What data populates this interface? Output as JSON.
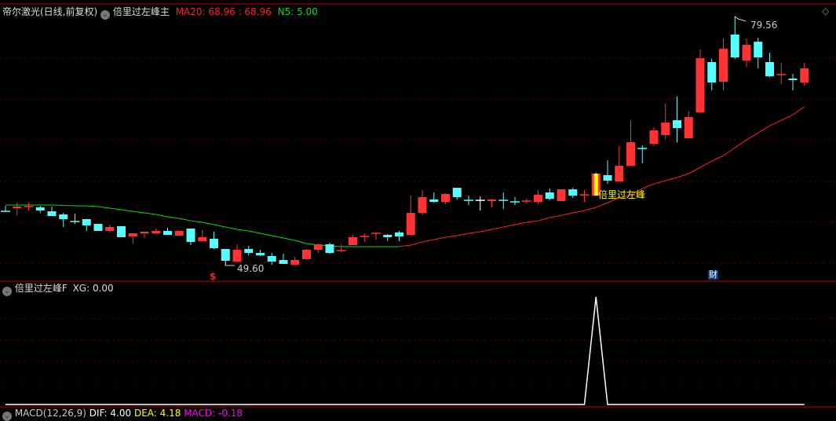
{
  "main_panel": {
    "stock_name": "帝尔激光(日线,前复权)",
    "indicator_name": "倍里过左峰主",
    "ma20_label": "MA20: 68.96",
    "ma20_value2": ": 68.96",
    "n5_label": "N5: 5.00",
    "high_marker": "79.56",
    "low_marker": "49.60",
    "signal_label": "倍里过左峰",
    "dollar_marker": "$",
    "finance_badge": "财",
    "colors": {
      "up": "#ff3333",
      "down": "#54ffff",
      "ma_up": "#ff2020",
      "ma_down": "#00e000",
      "signal": "#ffff00",
      "grid": "#8b0000",
      "border": "#c00000"
    }
  },
  "sub_panel": {
    "indicator_name": "倍里过左峰F",
    "xg_label": "XG: 0.00"
  },
  "macd_panel": {
    "name": "MACD(12,26,9)",
    "dif": "DIF: 4.00",
    "dea": "DEA: 4.18",
    "macd": "MACD: -0.18"
  },
  "icons": {
    "dropdown": "chevron-down-circle-icon",
    "corner": "diamond-icon"
  },
  "chart_data": {
    "type": "candlestick",
    "price_range": [
      49.6,
      79.56
    ],
    "signal_index": 51,
    "candles_ohlc": [
      [
        56.2,
        56.87,
        56.2,
        56.2
      ],
      [
        56.59,
        57.26,
        55.72,
        56.78
      ],
      [
        56.78,
        57.26,
        56.3,
        56.78
      ],
      [
        56.68,
        56.87,
        56.01,
        56.3
      ],
      [
        56.2,
        56.78,
        55.63,
        55.63
      ],
      [
        55.82,
        56.01,
        54.29,
        55.25
      ],
      [
        54.96,
        55.92,
        54.67,
        54.96
      ],
      [
        55.25,
        55.25,
        53.81,
        54.48
      ],
      [
        54.67,
        54.67,
        53.81,
        53.81
      ],
      [
        53.81,
        54.58,
        53.62,
        54.29
      ],
      [
        54.39,
        54.39,
        53.05,
        53.05
      ],
      [
        53.14,
        53.52,
        52.28,
        53.52
      ],
      [
        53.52,
        53.72,
        52.95,
        53.72
      ],
      [
        53.52,
        54.1,
        53.43,
        53.81
      ],
      [
        53.81,
        54.19,
        53.33,
        53.33
      ],
      [
        53.24,
        53.91,
        53.24,
        53.81
      ],
      [
        54.1,
        54.1,
        52.09,
        52.47
      ],
      [
        52.57,
        53.91,
        52.57,
        53.05
      ],
      [
        52.85,
        53.72,
        51.61,
        51.71
      ],
      [
        51.61,
        51.61,
        49.6,
        50.17
      ],
      [
        50.08,
        52.18,
        49.89,
        51.51
      ],
      [
        51.61,
        51.99,
        50.84,
        51.13
      ],
      [
        51.13,
        51.51,
        50.75,
        50.84
      ],
      [
        50.75,
        51.13,
        49.7,
        50.08
      ],
      [
        50.27,
        51.04,
        49.79,
        49.79
      ],
      [
        49.7,
        50.65,
        49.6,
        50.27
      ],
      [
        50.37,
        51.61,
        50.37,
        51.51
      ],
      [
        51.51,
        52.28,
        51.13,
        52.18
      ],
      [
        52.18,
        52.38,
        51.04,
        51.13
      ],
      [
        51.42,
        52.18,
        51.23,
        51.42
      ],
      [
        52.09,
        53.33,
        52.09,
        53.05
      ],
      [
        53.14,
        53.52,
        52.47,
        53.14
      ],
      [
        53.52,
        53.62,
        52.76,
        53.52
      ],
      [
        53.33,
        53.43,
        52.57,
        53.05
      ],
      [
        53.62,
        53.81,
        52.57,
        53.14
      ],
      [
        53.33,
        58.12,
        53.33,
        56.01
      ],
      [
        56.01,
        58.79,
        55.72,
        57.93
      ],
      [
        57.64,
        58.5,
        57.26,
        57.35
      ],
      [
        57.35,
        58.4,
        57.06,
        58.31
      ],
      [
        59.07,
        59.07,
        57.64,
        57.93
      ],
      [
        57.54,
        58.12,
        56.97,
        57.54
      ],
      [
        57.54,
        58.02,
        56.3,
        57.54
      ],
      [
        57.45,
        57.73,
        56.68,
        57.64
      ],
      [
        57.54,
        58.5,
        56.49,
        57.54
      ],
      [
        57.35,
        57.93,
        56.97,
        57.35
      ],
      [
        57.45,
        57.73,
        57.16,
        57.45
      ],
      [
        57.35,
        58.79,
        57.06,
        58.21
      ],
      [
        58.5,
        58.98,
        57.54,
        57.73
      ],
      [
        57.45,
        58.88,
        57.45,
        58.88
      ],
      [
        58.88,
        59.07,
        57.83,
        58.12
      ],
      [
        58.21,
        58.79,
        57.35,
        58.21
      ],
      [
        58.12,
        60.99,
        58.12,
        60.8
      ],
      [
        60.61,
        62.42,
        59.55,
        59.94
      ],
      [
        59.84,
        64.15,
        59.84,
        61.75
      ],
      [
        61.75,
        67.3,
        61.75,
        64.62
      ],
      [
        63.86,
        64.24,
        62.04,
        63.86
      ],
      [
        64.43,
        66.44,
        64.15,
        66.06
      ],
      [
        65.49,
        69.31,
        65.01,
        67.02
      ],
      [
        67.3,
        70.18,
        64.62,
        66.35
      ],
      [
        65.1,
        68.45,
        65.1,
        67.69
      ],
      [
        68.26,
        75.92,
        68.17,
        74.86
      ],
      [
        74.39,
        74.77,
        70.94,
        71.9
      ],
      [
        71.99,
        77.26,
        70.94,
        76.01
      ],
      [
        77.74,
        79.56,
        74.77,
        74.96
      ],
      [
        74.58,
        77.26,
        73.81,
        76.49
      ],
      [
        76.87,
        77.35,
        73.62,
        74.96
      ],
      [
        74.39,
        75.53,
        72.57,
        72.66
      ],
      [
        72.86,
        74.29,
        71.71,
        72.86
      ],
      [
        72.38,
        72.95,
        70.94,
        72.19
      ],
      [
        71.9,
        74.29,
        71.52,
        73.62
      ]
    ],
    "doji_colors": {
      "41": "#ffffff"
    },
    "ma20": [
      56.97,
      56.97,
      56.97,
      56.97,
      56.97,
      56.92,
      56.87,
      56.87,
      56.78,
      56.59,
      56.4,
      56.2,
      56.01,
      55.82,
      55.53,
      55.34,
      55.05,
      54.86,
      54.58,
      54.29,
      54.0,
      53.81,
      53.52,
      53.24,
      52.95,
      52.66,
      52.28,
      52.09,
      51.99,
      51.9,
      51.9,
      51.9,
      51.9,
      51.9,
      51.9,
      52.09,
      52.47,
      52.76,
      53.05,
      53.24,
      53.52,
      53.72,
      54.0,
      54.29,
      54.58,
      54.86,
      55.05,
      55.44,
      55.72,
      56.01,
      56.3,
      56.68,
      57.26,
      57.83,
      58.21,
      58.98,
      59.55,
      59.94,
      60.32,
      60.8,
      61.56,
      62.33,
      63.0,
      63.96,
      64.91,
      65.77,
      66.63,
      67.3,
      67.97,
      68.96
    ],
    "xg_values_note_free": true,
    "xg": [
      0,
      0,
      0,
      0,
      0,
      0,
      0,
      0,
      0,
      0,
      0,
      0,
      0,
      0,
      0,
      0,
      0,
      0,
      0,
      0,
      0,
      0,
      0,
      0,
      0,
      0,
      0,
      0,
      0,
      0,
      0,
      0,
      0,
      0,
      0,
      0,
      0,
      0,
      0,
      0,
      0,
      0,
      0,
      0,
      0,
      0,
      0,
      0,
      0,
      0,
      0,
      1,
      0,
      0,
      0,
      0,
      0,
      0,
      0,
      0,
      0,
      0,
      0,
      0,
      0,
      0,
      0,
      0,
      0,
      0
    ]
  }
}
